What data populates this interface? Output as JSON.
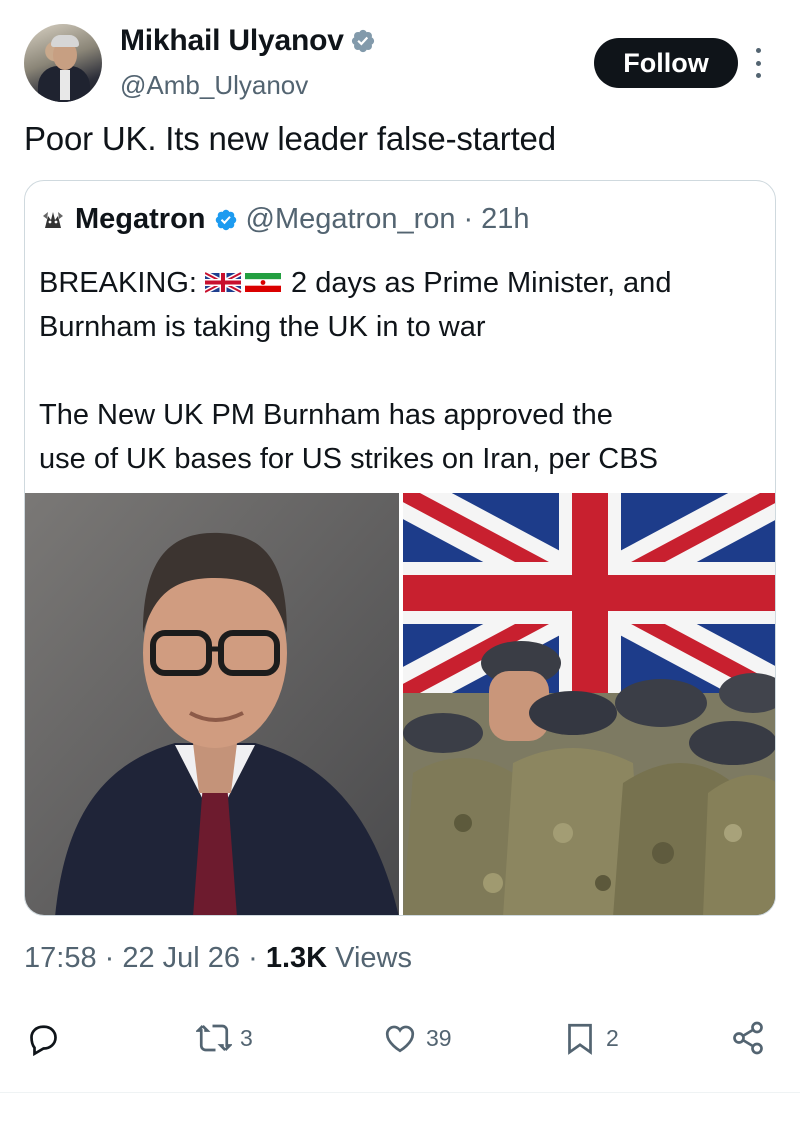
{
  "author": {
    "display_name": "Mikhail Ulyanov",
    "handle": "@Amb_Ulyanov",
    "verified_icon": "verified-badge-icon"
  },
  "follow_label": "Follow",
  "tweet_text": "Poor UK. Its new leader false-started",
  "quote": {
    "display_name": "Megatron",
    "handle": "@Megatron_ron",
    "separator": "·",
    "time": "21h",
    "line1_prefix": "BREAKING: ",
    "line1_suffix": " 2 days as Prime Minister, and",
    "line2": "Burnham is taking the UK in to war",
    "line3": "The New UK PM Burnham has approved the",
    "line4": "use of UK bases for US strikes on Iran, per CBS"
  },
  "meta": {
    "time": "17:58",
    "sep1": " · ",
    "date": "22 Jul 26",
    "sep2": " · ",
    "views_count": "1.3K",
    "views_label": " Views"
  },
  "actions": {
    "reply_icon": "reply-icon",
    "retweet_count": "3",
    "like_count": "39",
    "bookmark_count": "2",
    "share_icon": "share-icon"
  },
  "colors": {
    "text": "#0f1419",
    "secondary": "#536471",
    "verified": "#829aab",
    "verified_blue": "#1d9bf0",
    "border": "#cfd9de"
  }
}
